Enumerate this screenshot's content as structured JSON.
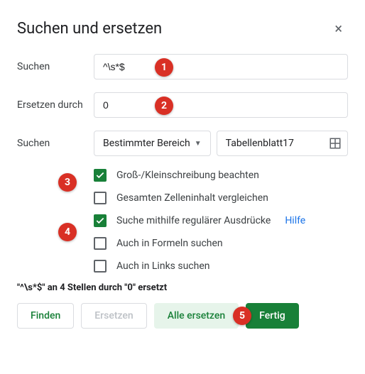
{
  "title": "Suchen und ersetzen",
  "labels": {
    "search": "Suchen",
    "replace": "Ersetzen durch",
    "scope": "Suchen"
  },
  "inputs": {
    "search_value": "^\\s*$",
    "replace_value": "0"
  },
  "scope": {
    "selected": "Bestimmter Bereich",
    "range": "Tabellenblatt17"
  },
  "checks": [
    {
      "label": "Groß-/Kleinschreibung beachten",
      "checked": true
    },
    {
      "label": "Gesamten Zelleninhalt vergleichen",
      "checked": false
    },
    {
      "label": "Suche mithilfe regulärer Ausdrücke",
      "checked": true,
      "help": "Hilfe"
    },
    {
      "label": "Auch in Formeln suchen",
      "checked": false
    },
    {
      "label": "Auch in Links suchen",
      "checked": false
    }
  ],
  "status": "\"^\\s*$\" an 4 Stellen durch \"0\" ersetzt",
  "buttons": {
    "find": "Finden",
    "replace": "Ersetzen",
    "replace_all": "Alle ersetzen",
    "done": "Fertig"
  },
  "callouts": {
    "1": "1",
    "2": "2",
    "3": "3",
    "4": "4",
    "5": "5"
  }
}
